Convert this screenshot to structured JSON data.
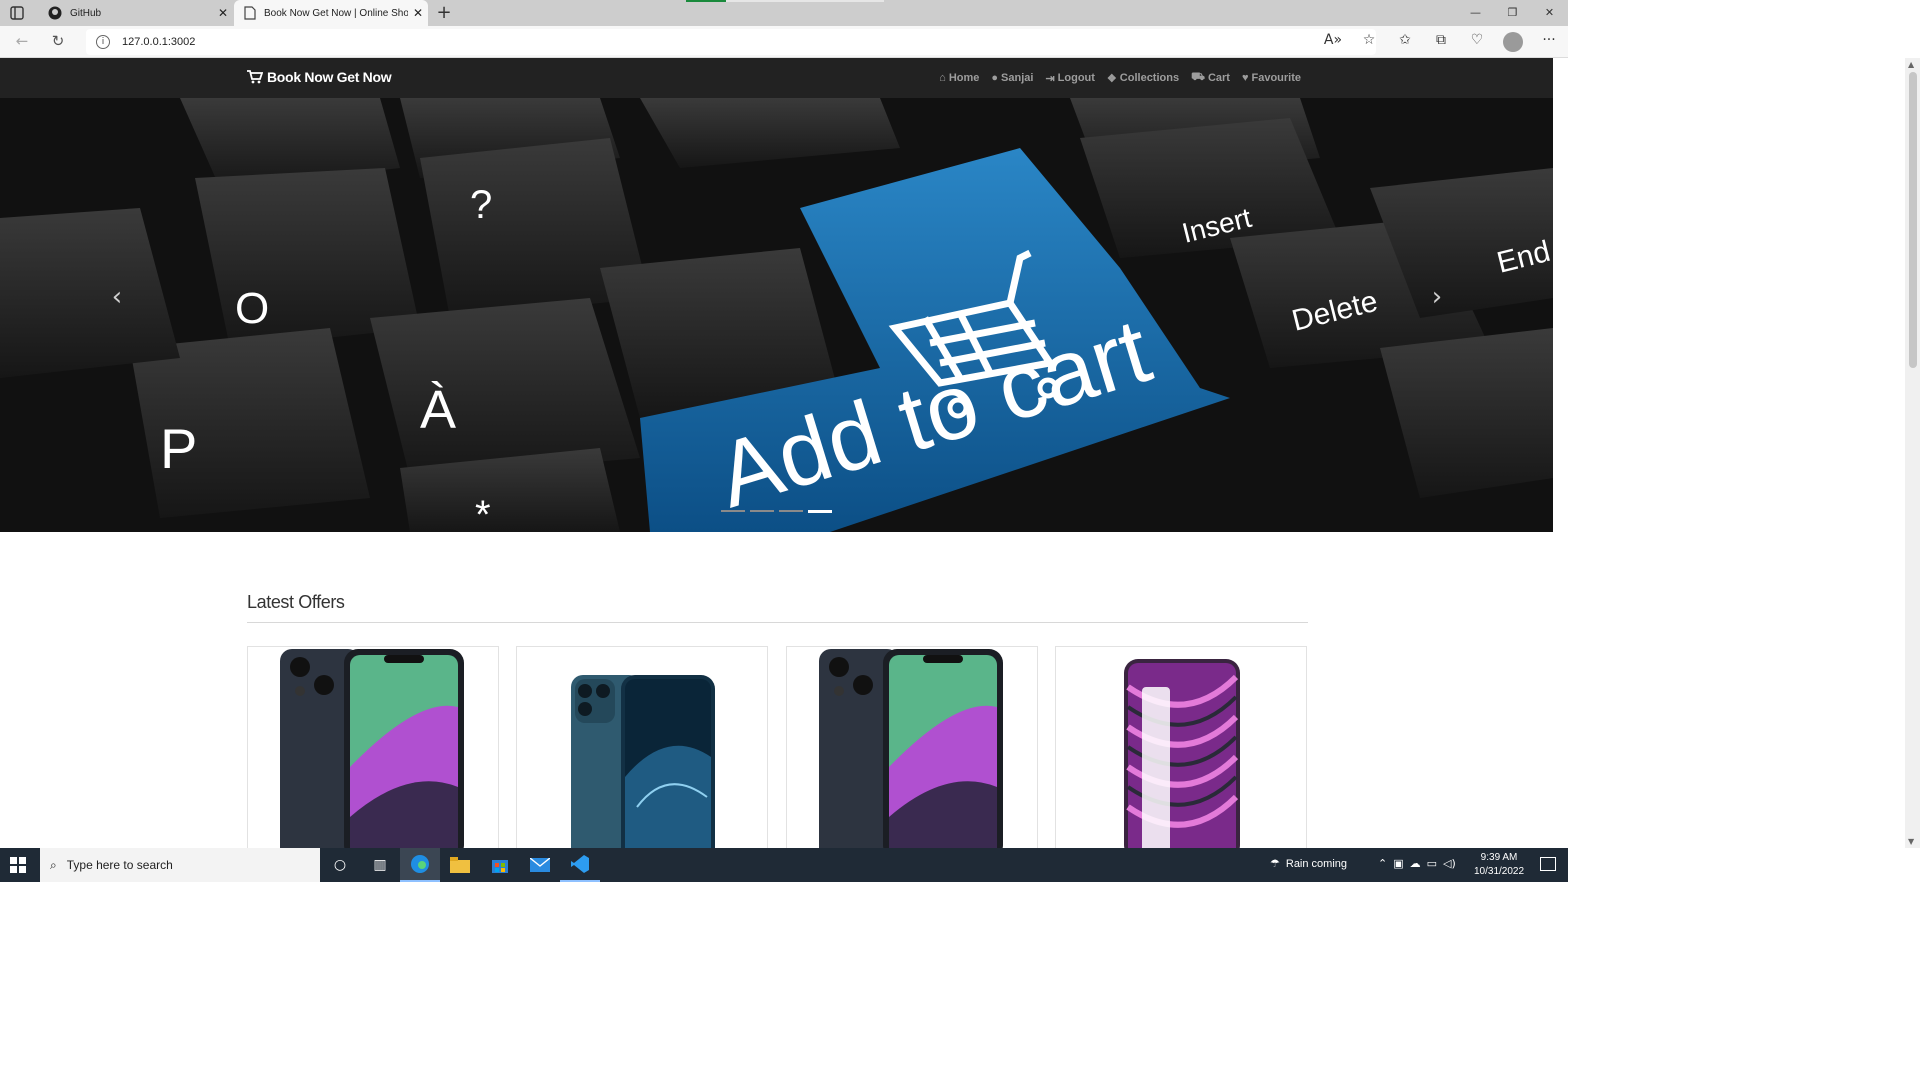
{
  "browser": {
    "tabs": [
      {
        "title": "GitHub",
        "icon": "github-icon"
      },
      {
        "title": "Book Now Get Now | Online Sho",
        "icon": "page-icon"
      }
    ],
    "url": "127.0.0.1:3002"
  },
  "navbar": {
    "brand": "Book Now Get Now",
    "links": [
      {
        "label": "Home",
        "icon": "home-icon"
      },
      {
        "label": "Sanjai",
        "icon": "user-icon"
      },
      {
        "label": "Logout",
        "icon": "logout-icon"
      },
      {
        "label": "Collections",
        "icon": "cubes-icon"
      },
      {
        "label": "Cart",
        "icon": "cart-icon"
      },
      {
        "label": "Favourite",
        "icon": "heart-icon"
      }
    ]
  },
  "carousel": {
    "slide_text": "Add to cart",
    "key_labels": [
      "Insert",
      "Delete",
      "End",
      "P",
      "À",
      "O",
      "?",
      "*"
    ],
    "indicator_count": 4,
    "active_indicator": 4
  },
  "offers": {
    "title": "Latest Offers",
    "products": [
      {
        "image": "iphone-14-image"
      },
      {
        "image": "iphone-12-pro-image"
      },
      {
        "image": "iphone-14-image"
      },
      {
        "image": "realme-narzo-image"
      }
    ]
  },
  "taskbar": {
    "search_placeholder": "Type here to search",
    "weather": "Rain coming",
    "time": "9:39 AM",
    "date": "10/31/2022"
  }
}
